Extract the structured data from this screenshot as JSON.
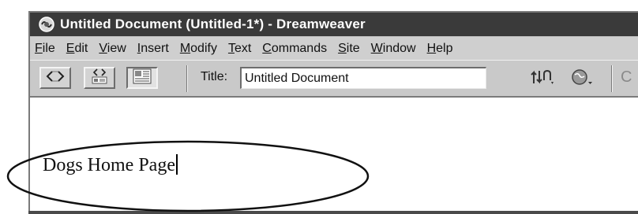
{
  "window": {
    "title": "Untitled Document (Untitled-1*) - Dreamweaver",
    "app_icon": "dreamweaver-logo-icon"
  },
  "menubar": {
    "items": [
      {
        "mnemonic": "F",
        "rest": "ile"
      },
      {
        "mnemonic": "E",
        "rest": "dit"
      },
      {
        "mnemonic": "V",
        "rest": "iew"
      },
      {
        "mnemonic": "I",
        "rest": "nsert"
      },
      {
        "mnemonic": "M",
        "rest": "odify"
      },
      {
        "mnemonic": "T",
        "rest": "ext"
      },
      {
        "mnemonic": "C",
        "rest": "ommands"
      },
      {
        "mnemonic": "S",
        "rest": "ite"
      },
      {
        "mnemonic": "W",
        "rest": "indow"
      },
      {
        "mnemonic": "H",
        "rest": "elp"
      }
    ]
  },
  "toolbar": {
    "code_view_icon": "code-view-icon",
    "split_view_icon": "code-and-design-view-icon",
    "design_view_icon": "design-view-icon",
    "title_label": "Title:",
    "title_value": "Untitled Document",
    "file_management_icon": "file-management-icon",
    "preview_icon": "preview-in-browser-icon",
    "refresh_glyph": "C"
  },
  "document": {
    "text": "Dogs Home Page"
  },
  "annotation": {
    "shape": "ellipse-callout"
  },
  "colors": {
    "titlebar": "#3a3a3a",
    "chrome": "#c6c6c6",
    "document_bg": "#ffffff"
  }
}
